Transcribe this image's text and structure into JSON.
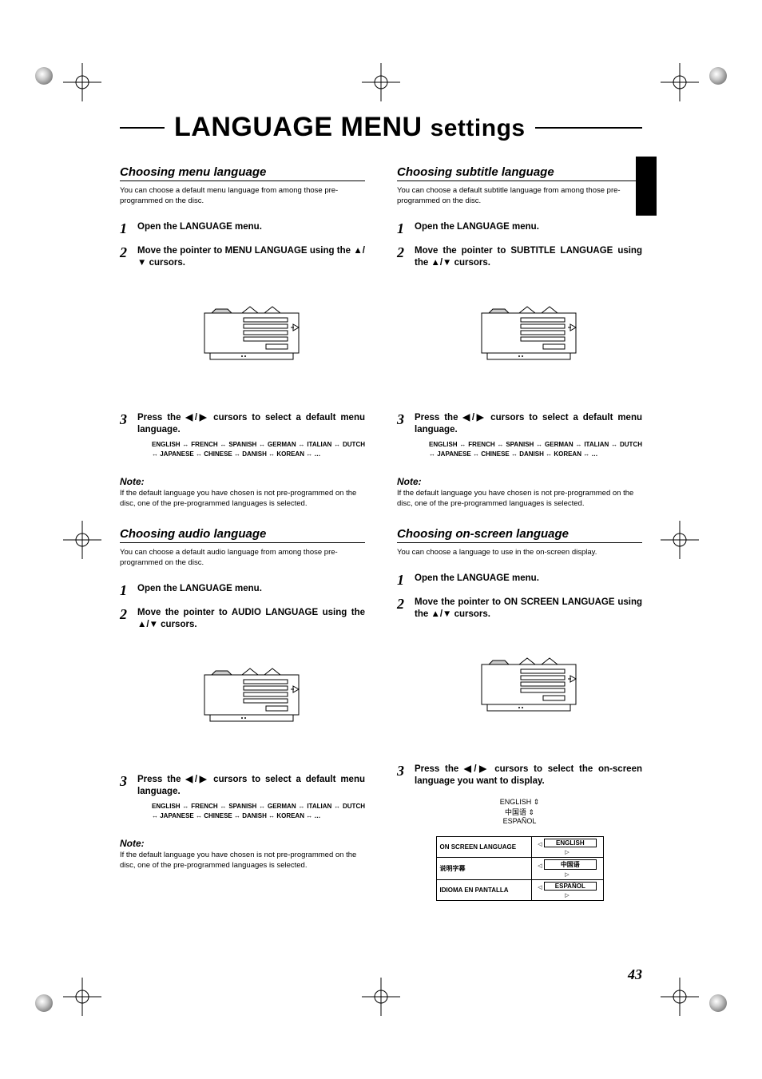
{
  "title_main": "LANGUAGE MENU",
  "title_sub": "settings",
  "page_number": "43",
  "left": {
    "sec1": {
      "heading": "Choosing menu language",
      "sub": "You can choose a default menu language from among those pre-programmed on the disc.",
      "steps": [
        "Open the LANGUAGE menu.",
        "Move the pointer to MENU LANGUAGE using the ▲/▼ cursors.",
        "Press the ◀/▶ cursors to select a default menu language."
      ],
      "flow": "ENGLISH ↔ FRENCH ↔ SPANISH ↔ GERMAN ↔ ITALIAN ↔ DUTCH ↔ JAPANESE ↔ CHINESE ↔ DANISH ↔ KOREAN ↔ …",
      "note": "Note:",
      "note_body": "If the default language you have chosen is not pre-programmed on the disc, one of the pre-programmed languages is selected."
    },
    "sec2": {
      "heading": "Choosing audio language",
      "sub": "You can choose a default audio language from among those pre-programmed on the disc.",
      "steps": [
        "Open the LANGUAGE menu.",
        "Move the pointer to AUDIO LANGUAGE using the ▲/▼ cursors.",
        "Press the ◀/▶ cursors to select a default menu language."
      ],
      "flow": "ENGLISH ↔ FRENCH ↔ SPANISH ↔ GERMAN ↔ ITALIAN ↔ DUTCH ↔ JAPANESE ↔ CHINESE ↔ DANISH ↔ KOREAN ↔ …",
      "note": "Note:",
      "note_body": "If the default language you have chosen is not pre-programmed on the disc, one of the pre-programmed languages is selected."
    }
  },
  "right": {
    "sec1": {
      "heading": "Choosing subtitle language",
      "sub": "You can choose a default subtitle language from among those pre-programmed on the disc.",
      "steps": [
        "Open the LANGUAGE menu.",
        "Move the pointer to SUBTITLE LANGUAGE using the ▲/▼  cursors.",
        "Press the ◀/▶ cursors to select a default menu language."
      ],
      "flow": "ENGLISH ↔ FRENCH ↔ SPANISH ↔ GERMAN ↔ ITALIAN ↔ DUTCH ↔ JAPANESE ↔ CHINESE ↔ DANISH ↔ KOREAN ↔ …",
      "note": "Note:",
      "note_body": "If the default language you have chosen is not pre-programmed on the disc, one of the pre-programmed languages is selected."
    },
    "sec2": {
      "heading": "Choosing on-screen language",
      "sub": "You can choose a language to use in the on-screen display.",
      "steps": [
        "Open the LANGUAGE menu.",
        "Move the pointer to ON SCREEN LANGUAGE using the ▲/▼  cursors.",
        "Press the ◀/▶ cursors to select the on-screen language you want to display."
      ],
      "flow_lines": [
        "ENGLISH   ⇕",
        "中国语   ⇕",
        "ESPAÑOL"
      ],
      "table": [
        {
          "label": "ON SCREEN LANGUAGE",
          "value": "ENGLISH"
        },
        {
          "label": "说明字幕",
          "value": "中国语"
        },
        {
          "label": "IDIOMA EN PANTALLA",
          "value": "ESPAÑOL"
        }
      ]
    }
  }
}
